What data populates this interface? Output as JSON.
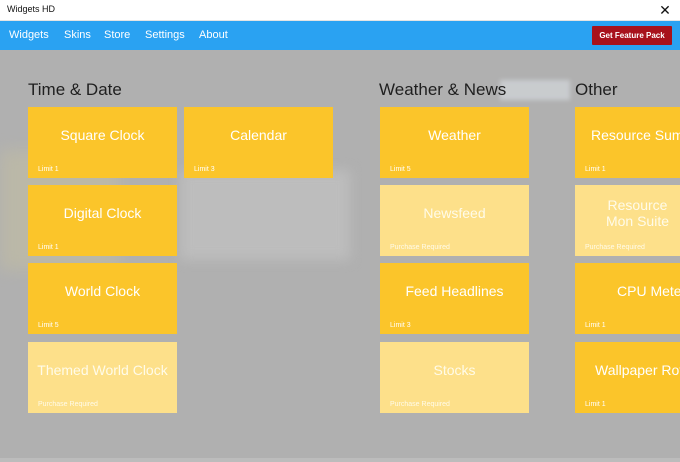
{
  "window": {
    "title": "Widgets HD",
    "close_glyph": "✕"
  },
  "menu": {
    "items": [
      {
        "label": "Widgets"
      },
      {
        "label": "Skins"
      },
      {
        "label": "Store"
      },
      {
        "label": "Settings"
      },
      {
        "label": "About"
      }
    ],
    "feature_button": "Get Feature Pack"
  },
  "sections": [
    {
      "title": "Time & Date",
      "tiles": [
        {
          "name": "Square Clock",
          "sub": "Limit 1",
          "faded": false
        },
        {
          "name": "Calendar",
          "sub": "Limit 3",
          "faded": false
        },
        {
          "name": "Digital Clock",
          "sub": "Limit 1",
          "faded": false
        },
        {
          "name": "World Clock",
          "sub": "Limit 5",
          "faded": false
        },
        {
          "name": "Themed World Clock",
          "sub": "Purchase Required",
          "faded": true
        }
      ]
    },
    {
      "title": "Weather & News",
      "tiles": [
        {
          "name": "Weather",
          "sub": "Limit 5",
          "faded": false
        },
        {
          "name": "Newsfeed",
          "sub": "Purchase Required",
          "faded": true
        },
        {
          "name": "Feed Headlines",
          "sub": "Limit 3",
          "faded": false
        },
        {
          "name": "Stocks",
          "sub": "Purchase Required",
          "faded": true
        }
      ]
    },
    {
      "title": "Other",
      "tiles": [
        {
          "name": "Resource Summ",
          "sub": "Limit 1",
          "faded": false
        },
        {
          "name": "Resource Mon Suite",
          "sub": "Purchase Required",
          "faded": true
        },
        {
          "name": "CPU Mete",
          "sub": "Limit 1",
          "faded": false
        },
        {
          "name": "Wallpaper Rot",
          "sub": "Limit 1",
          "faded": false
        }
      ]
    }
  ],
  "colors": {
    "menubar": "#2aa2f2",
    "tile": "#fbc52a",
    "tile_locked": "#fde08a",
    "feature_button": "#a8121c"
  }
}
